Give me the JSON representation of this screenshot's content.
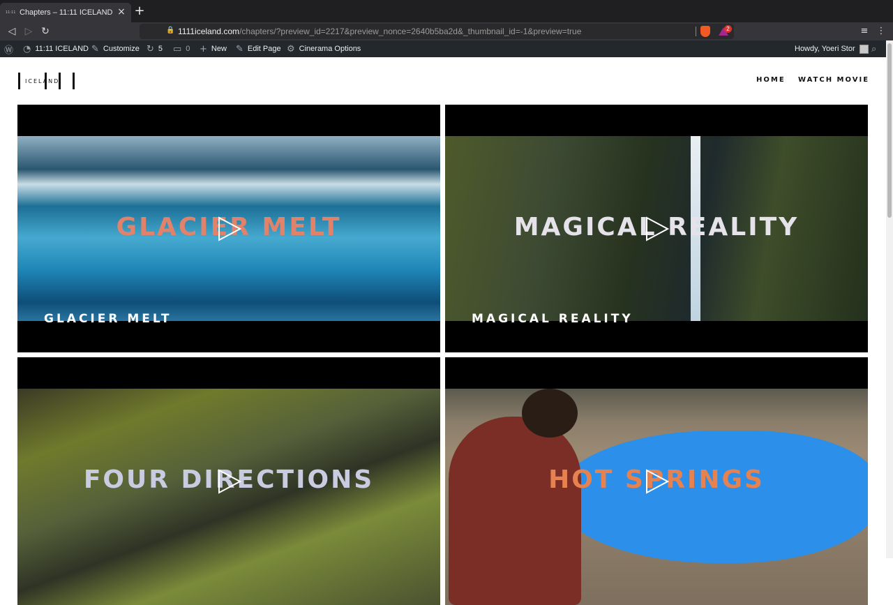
{
  "browser": {
    "tab_title": "Chapters – 11:11 ICELAND",
    "tab_favicon_text": "11:11",
    "url_host": "1111iceland.com",
    "url_path": "/chapters/?preview_id=2217&preview_nonce=2640b5ba2d&_thumbnail_id=-1&preview=true",
    "rewards_badge": "2"
  },
  "admin_bar": {
    "site_name": "11:11 ICELAND",
    "customize": "Customize",
    "updates_count": "5",
    "comments_count": "0",
    "new": "New",
    "edit_page": "Edit Page",
    "cinerama_options": "Cinerama Options",
    "howdy": "Howdy, Yoeri Stor"
  },
  "site": {
    "logo_text": "ICELAND",
    "nav": [
      "HOME",
      "WATCH MOVIE"
    ]
  },
  "chapters": [
    {
      "title": "GLACIER MELT",
      "overlay": "GLACIER MELT",
      "overlay_color": "#e0836a"
    },
    {
      "title": "MAGICAL REALITY",
      "overlay": "MAGICAL REALITY",
      "overlay_color": "#e6e2ea"
    },
    {
      "title": "FOUR DIRECTIONS",
      "overlay": "FOUR DIRECTIONS",
      "overlay_color": "#c9cce0"
    },
    {
      "title": "HOT SPRINGS",
      "overlay": "HOT SPRINGS",
      "overlay_color": "#e6824f"
    }
  ]
}
